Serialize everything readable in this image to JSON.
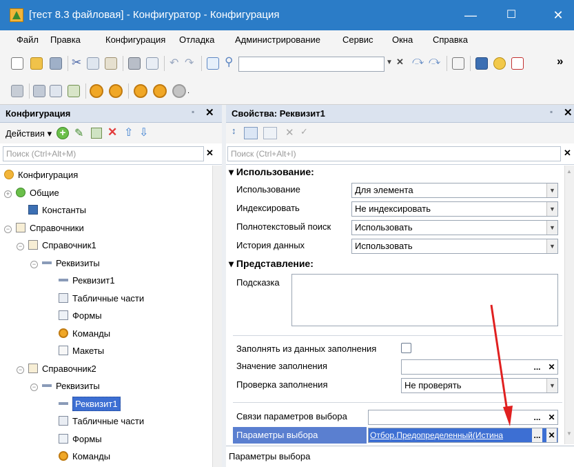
{
  "window": {
    "title": "[тест 8.3 файловая] - Конфигуратор - Конфигурация",
    "minimize": "—",
    "maximize": "☐",
    "close": "✕"
  },
  "menu": [
    "Файл",
    "Правка",
    "Конфигурация",
    "Отладка",
    "Администрирование",
    "Сервис",
    "Окна",
    "Справка"
  ],
  "toolbar_overflow": "»",
  "config_panel": {
    "title": "Конфигурация",
    "close": "✕",
    "actions_label": "Действия ▾",
    "search_placeholder": "Поиск (Ctrl+Alt+M)",
    "search_clear": "✕",
    "tree": [
      {
        "label": "Конфигурация",
        "level": 0,
        "icon": "config-icon",
        "expander": ""
      },
      {
        "label": "Общие",
        "level": 0,
        "icon": "common-icon",
        "expander": "+"
      },
      {
        "label": "Константы",
        "level": 1,
        "icon": "constants-icon",
        "expander": ""
      },
      {
        "label": "Справочники",
        "level": 0,
        "icon": "catalog-icon",
        "expander": "−"
      },
      {
        "label": "Справочник1",
        "level": 1,
        "icon": "catalog-icon",
        "expander": "−"
      },
      {
        "label": "Реквизиты",
        "level": 2,
        "icon": "attributes-icon",
        "expander": "−"
      },
      {
        "label": "Реквизит1",
        "level": 3,
        "icon": "attribute-icon",
        "expander": ""
      },
      {
        "label": "Табличные части",
        "level": 3,
        "icon": "tabular-icon",
        "expander": ""
      },
      {
        "label": "Формы",
        "level": 3,
        "icon": "form-icon",
        "expander": ""
      },
      {
        "label": "Команды",
        "level": 3,
        "icon": "command-icon",
        "expander": ""
      },
      {
        "label": "Макеты",
        "level": 3,
        "icon": "template-icon",
        "expander": ""
      },
      {
        "label": "Справочник2",
        "level": 1,
        "icon": "catalog-icon",
        "expander": "−"
      },
      {
        "label": "Реквизиты",
        "level": 2,
        "icon": "attributes-icon",
        "expander": "−"
      },
      {
        "label": "Реквизит1",
        "level": 3,
        "icon": "attribute-icon",
        "expander": "",
        "selected": true
      },
      {
        "label": "Табличные части",
        "level": 3,
        "icon": "tabular-icon",
        "expander": ""
      },
      {
        "label": "Формы",
        "level": 3,
        "icon": "form-icon",
        "expander": ""
      },
      {
        "label": "Команды",
        "level": 3,
        "icon": "command-icon",
        "expander": ""
      }
    ]
  },
  "props_panel": {
    "title": "Свойства: Реквизит1",
    "close": "✕",
    "search_placeholder": "Поиск (Ctrl+Alt+I)",
    "search_clear": "✕",
    "section_usage": "Использование:",
    "usage_rows": [
      {
        "label": "Использование",
        "value": "Для элемента"
      },
      {
        "label": "Индексировать",
        "value": "Не индексировать"
      },
      {
        "label": "Полнотекстовый поиск",
        "value": "Использовать"
      },
      {
        "label": "История данных",
        "value": "Использовать"
      }
    ],
    "section_view": "Представление:",
    "hint_label": "Подсказка",
    "fill_from_data_label": "Заполнять из данных заполнения",
    "fill_value_label": "Значение заполнения",
    "fill_value": "",
    "fill_check_label": "Проверка заполнения",
    "fill_check_value": "Не проверять",
    "choice_links_label": "Связи параметров выбора",
    "choice_links_value": "",
    "choice_params_label": "Параметры выбора",
    "choice_params_value": "Отбор.Предопределенный(Истина",
    "status_text": "Параметры выбора",
    "ellipsis": "...",
    "clear": "✕",
    "dropdown": "▼"
  },
  "colors": {
    "titlebar": "#2b7cc7",
    "selection": "#3d6fd3",
    "highlight_row": "#5a7fd0",
    "arrow": "#e02020"
  }
}
